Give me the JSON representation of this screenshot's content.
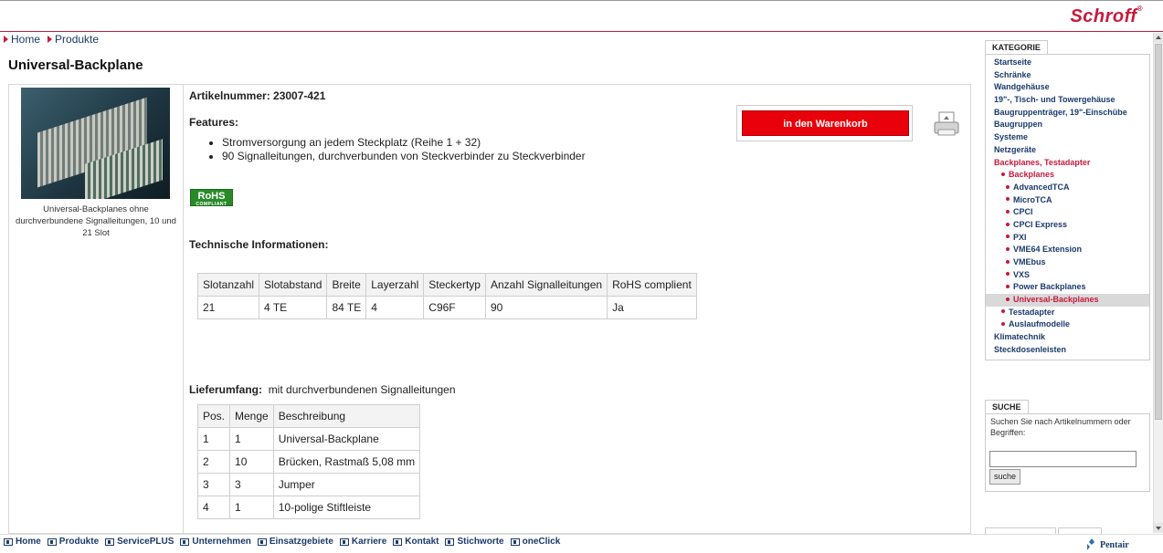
{
  "brand": {
    "logo": "Schroff",
    "logo_mark": "®",
    "footer_logo": "Pentair"
  },
  "breadcrumb": [
    {
      "label": "Home"
    },
    {
      "label": "Produkte"
    }
  ],
  "page_title": "Universal-Backplane",
  "product": {
    "image_caption": "Universal-Backplanes ohne durchverbundene Signalleitungen, 10 und 21 Slot",
    "article_number": "Artikelnummer: 23007-421",
    "features_heading": "Features:",
    "features": [
      "Stromversorgung an jedem Steckplatz (Reihe 1 + 32)",
      "90 Signalleitungen, durchverbunden von Steckverbinder zu Steckverbinder"
    ],
    "rohs_badge": "RoHS",
    "rohs_badge_sub": "COMPLIANT",
    "tech_heading": "Technische Informationen:",
    "cart_button": "in den Warenkorb"
  },
  "tech_table": {
    "headers": [
      "Slotanzahl",
      "Slotabstand",
      "Breite",
      "Layerzahl",
      "Steckertyp",
      "Anzahl Signalleitungen",
      "RoHS complient"
    ],
    "row": [
      "21",
      "4 TE",
      "84 TE",
      "4",
      "C96F",
      "90",
      "Ja"
    ]
  },
  "scope": {
    "label": "Lieferumfang:",
    "value": "mit durchverbundenen Signalleitungen",
    "headers": [
      "Pos.",
      "Menge",
      "Beschreibung"
    ],
    "rows": [
      [
        "1",
        "1",
        "Universal-Backplane"
      ],
      [
        "2",
        "10",
        "Brücken, Rastmaß 5,08 mm"
      ],
      [
        "3",
        "3",
        "Jumper"
      ],
      [
        "4",
        "1",
        "10-polige Stiftleiste"
      ]
    ]
  },
  "sidebar": {
    "category_tab": "KATEGORIE",
    "categories": [
      {
        "label": "Startseite"
      },
      {
        "label": "Schränke"
      },
      {
        "label": "Wandgehäuse"
      },
      {
        "label": "19\"-, Tisch- und Towergehäuse"
      },
      {
        "label": "Baugruppenträger, 19\"-Einschübe"
      },
      {
        "label": "Baugruppen"
      },
      {
        "label": "Systeme"
      },
      {
        "label": "Netzgeräte"
      },
      {
        "label": "Backplanes, Testadapter"
      },
      {
        "label": "Backplanes"
      },
      {
        "label": "AdvancedTCA"
      },
      {
        "label": "MicroTCA"
      },
      {
        "label": "CPCI"
      },
      {
        "label": "CPCI Express"
      },
      {
        "label": "PXI"
      },
      {
        "label": "VME64 Extension"
      },
      {
        "label": "VMEbus"
      },
      {
        "label": "VXS"
      },
      {
        "label": "Power Backplanes"
      },
      {
        "label": "Universal-Backplanes"
      },
      {
        "label": "Testadapter"
      },
      {
        "label": "Auslaufmodelle"
      },
      {
        "label": "Klimatechnik"
      },
      {
        "label": "Steckdosenleisten"
      }
    ],
    "search_tab": "SUCHE",
    "search_hint": "Suchen Sie nach Artikelnummern oder Begriffen:",
    "search_value": "",
    "search_button": "suche"
  },
  "footer_nav": [
    "Home",
    "Produkte",
    "ServicePLUS",
    "Unternehmen",
    "Einsatzgebiete",
    "Karriere",
    "Kontakt",
    "Stichworte",
    "oneClick"
  ],
  "colors": {
    "accent": "#c8193c",
    "link": "#1a3a6b",
    "cart": "#e8000b"
  }
}
